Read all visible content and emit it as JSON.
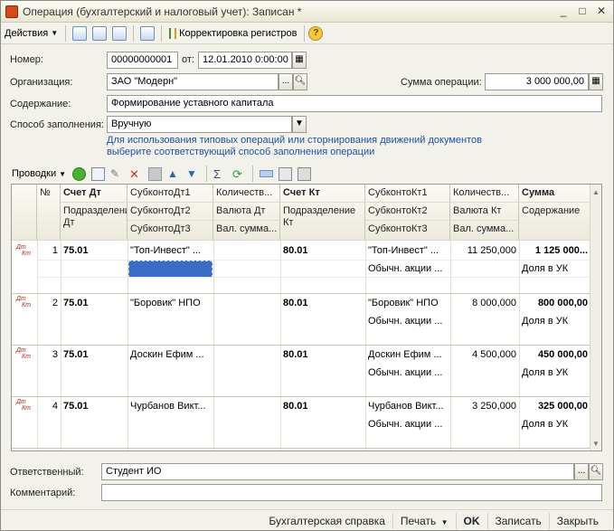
{
  "window": {
    "title": "Операция (бухгалтерский и налоговый учет): Записан *",
    "minimize": "_",
    "maximize": "□",
    "close": "✕"
  },
  "toolbar": {
    "actions_label": "Действия",
    "registers_label": "Корректировка регистров"
  },
  "form": {
    "number_label": "Номер:",
    "number_value": "00000000001",
    "date_label": "от:",
    "date_value": "12.01.2010  0:00:00",
    "org_label": "Организация:",
    "org_value": "ЗАО \"Модерн\"",
    "sum_label": "Сумма операции:",
    "sum_value": "3 000 000,00",
    "content_label": "Содержание:",
    "content_value": "Формирование уставного капитала",
    "fill_label": "Способ заполнения:",
    "fill_value": "Вручную",
    "hint": "Для использования типовых операций или сторнирования движений документов выберите соответствующий способ заполнения операции"
  },
  "grid_toolbar": {
    "label": "Проводки"
  },
  "grid": {
    "headers": {
      "num": "№",
      "account_dt": "Счет Дт",
      "dt_division": "Подразделение Дт",
      "subconto_dt1": "СубконтоДт1",
      "subconto_dt2": "СубконтоДт2",
      "subconto_dt3": "СубконтоДт3",
      "qty_dt": "Количеств...",
      "currency_dt": "Валюта Дт",
      "cur_sum_dt": "Вал. сумма...",
      "account_kt": "Счет Кт",
      "kt_division": "Подразделение Кт",
      "subconto_kt1": "СубконтоКт1",
      "subconto_kt2": "СубконтоКт2",
      "subconto_kt3": "СубконтоКт3",
      "qty_kt": "Количеств...",
      "currency_kt": "Валюта Кт",
      "cur_sum_kt": "Вал. сумма...",
      "sum": "Сумма",
      "content": "Содержание"
    },
    "rows": [
      {
        "num": "1",
        "account_dt": "75.01",
        "subconto_dt1": "\"Топ-Инвест\" ...",
        "account_kt": "80.01",
        "subconto_kt1": "\"Топ-Инвест\" ...",
        "subconto_kt2": "Обычн. акции ...",
        "qty_kt": "11 250,000",
        "sum": "1 125 000...",
        "content": "Доля в УК"
      },
      {
        "num": "2",
        "account_dt": "75.01",
        "subconto_dt1": "\"Боровик\" НПО",
        "account_kt": "80.01",
        "subconto_kt1": "\"Боровик\" НПО",
        "subconto_kt2": "Обычн. акции ...",
        "qty_kt": "8 000,000",
        "sum": "800 000,00",
        "content": "Доля в УК"
      },
      {
        "num": "3",
        "account_dt": "75.01",
        "subconto_dt1": "Доскин Ефим ...",
        "account_kt": "80.01",
        "subconto_kt1": "Доскин Ефим ...",
        "subconto_kt2": "Обычн. акции ...",
        "qty_kt": "4 500,000",
        "sum": "450 000,00",
        "content": "Доля в УК"
      },
      {
        "num": "4",
        "account_dt": "75.01",
        "subconto_dt1": "Чурбанов Викт...",
        "account_kt": "80.01",
        "subconto_kt1": "Чурбанов Викт...",
        "subconto_kt2": "Обычн. акции ...",
        "qty_kt": "3 250,000",
        "sum": "325 000,00",
        "content": "Доля в УК"
      }
    ],
    "row_icon": {
      "top": "Дт",
      "bottom": "Кт"
    }
  },
  "footer": {
    "responsible_label": "Ответственный:",
    "responsible_value": "Студент ИО",
    "comment_label": "Комментарий:",
    "comment_value": ""
  },
  "bottom_buttons": {
    "report": "Бухгалтерская справка",
    "print": "Печать",
    "ok": "OK",
    "save": "Записать",
    "close": "Закрыть"
  }
}
